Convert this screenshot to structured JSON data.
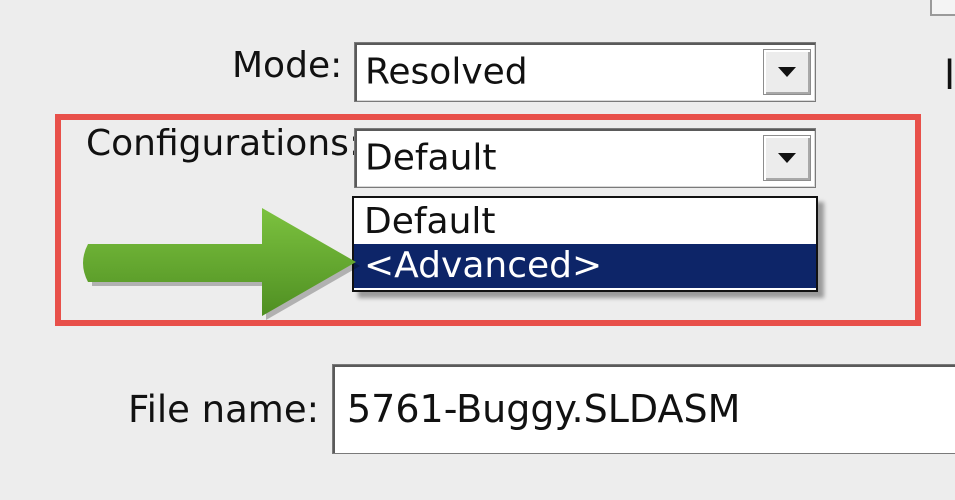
{
  "mode": {
    "label": "Mode:",
    "selected": "Resolved"
  },
  "configurations": {
    "label": "Configurations:",
    "selected": "Default",
    "options": [
      "Default",
      "<Advanced>"
    ],
    "highlighted_option": "<Advanced>"
  },
  "file_name": {
    "label": "File name:",
    "value": "5761-Buggy.SLDASM"
  },
  "icons": {
    "dropdown_arrow": "triangle-down-icon",
    "annotation_arrow": "green-arrow-right-icon"
  },
  "colors": {
    "highlight_box": "#e8504a",
    "selection_background": "#0d2568",
    "annotation_arrow": "#5ea32a"
  }
}
